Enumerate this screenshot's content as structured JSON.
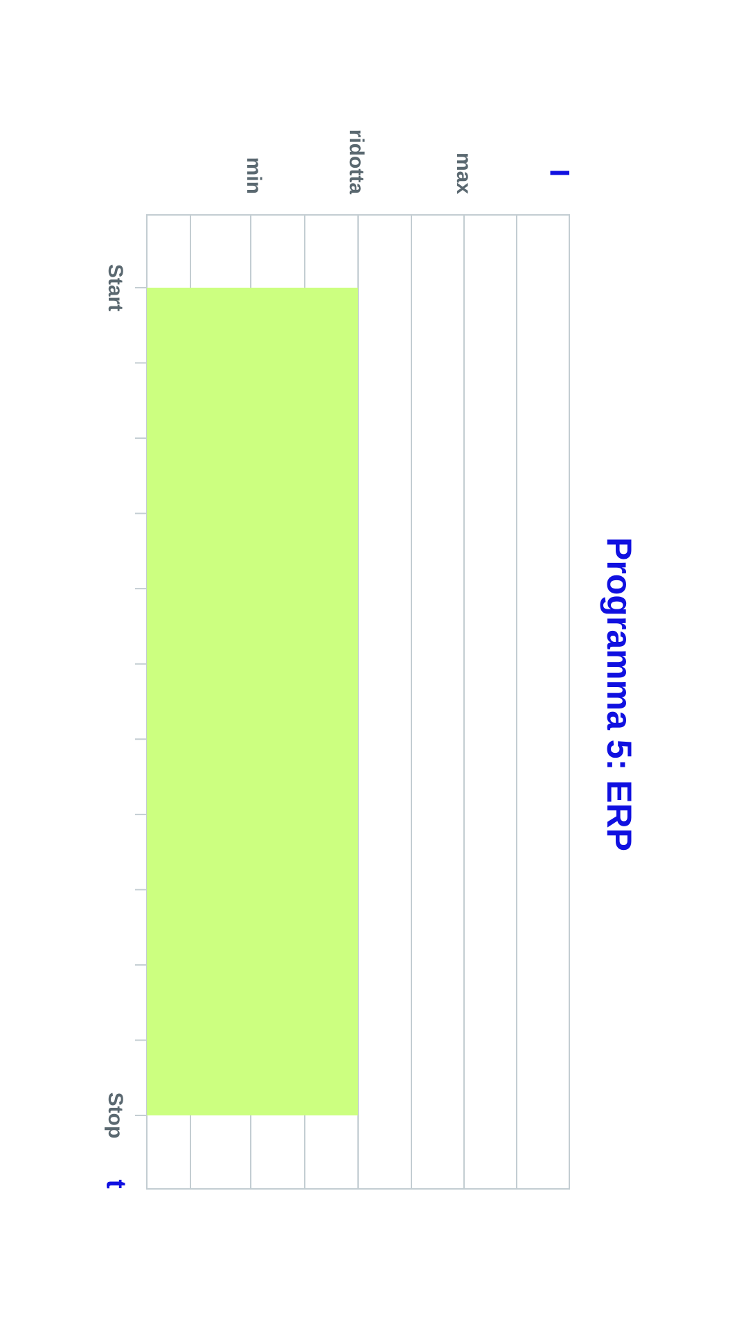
{
  "chart_data": {
    "type": "area",
    "title": "Programma 5: ERP",
    "xlabel": "t",
    "ylabel": "I",
    "x_tick_labels": [
      "Start",
      "Stop"
    ],
    "y_tick_labels": [
      "min",
      "ridotta",
      "max"
    ],
    "series": [
      {
        "x": [
          "Start",
          "Stop"
        ],
        "y": [
          "ridotta",
          "ridotta"
        ]
      }
    ],
    "grid": true,
    "orientation": "rotated 90° clockwise"
  },
  "colors": {
    "fill": "#ccff80",
    "grid": "#c3cdd2",
    "title": "#1010e0",
    "tick_text": "#5a6870"
  }
}
